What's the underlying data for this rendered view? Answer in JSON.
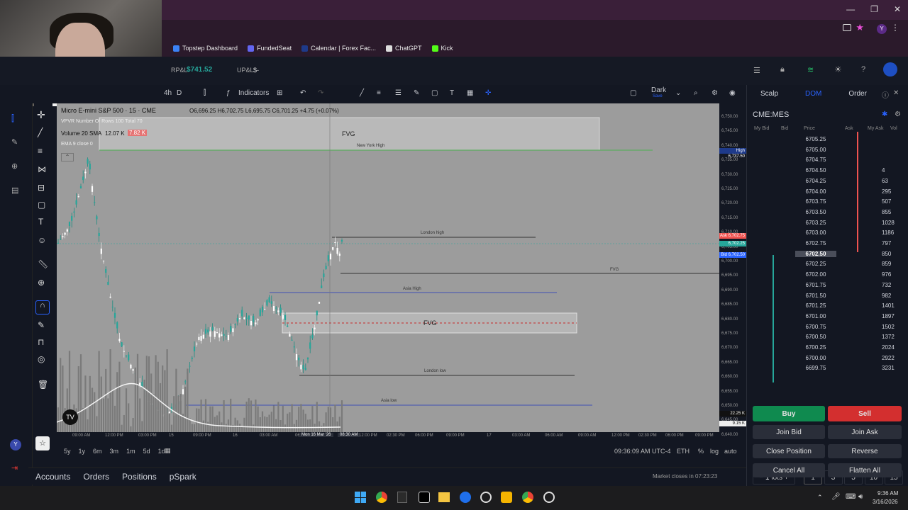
{
  "browser": {
    "bookmarks": [
      "Topstep Dashboard",
      "FundedSeat",
      "Calendar | Forex Fac...",
      "ChatGPT",
      "Kick"
    ],
    "bookmark_colors": [
      "#3b82f6",
      "#6366f1",
      "#1e3a8a",
      "#dddddd",
      "#53fc18"
    ],
    "profile_initial": "Y"
  },
  "header": {
    "rpl_label": "RP&L",
    "rpl_value": "$741.52",
    "upl_label": "UP&L",
    "upl_value": "$-",
    "positive_color": "#26a69a"
  },
  "toolbar": {
    "interval_4h": "4h",
    "interval_d": "D",
    "indicators": "Indicators",
    "theme": "Dark",
    "theme_sub": "Save"
  },
  "chart": {
    "symbol_line": "Micro E-mini S&P 500 · 15 · CME",
    "ohlc": "O6,696.25 H6,702.75 L6,695.75 C6,701.25 +4.75 (+0.07%)",
    "vpvr": "VPVR Number Of Rows 100 Total 70",
    "volume_label": "Volume 20 SMA",
    "volume_v1": "12.07 K",
    "volume_v2": "7.82 K",
    "ema_label": "EMA 9 close 0",
    "zones": {
      "fvg_top": "FVG",
      "new_york_high": "New York High",
      "london_high": "London high",
      "fvg_right": "FVG",
      "asia_high": "Asia High",
      "fvg_mid": "FVG",
      "london_low": "London low",
      "asia_low": "Asia low"
    }
  },
  "price_axis": {
    "ticks": [
      "6,750.00",
      "6,745.00",
      "6,740.00",
      "6,735.00",
      "6,730.00",
      "6,725.00",
      "6,720.00",
      "6,715.00",
      "6,710.00",
      "6,705.00",
      "6,700.00",
      "6,695.00",
      "6,690.00",
      "6,685.00",
      "6,680.00",
      "6,675.00",
      "6,670.00",
      "6,665.00",
      "6,660.00",
      "6,655.00",
      "6,650.00",
      "6,645.00",
      "6,640.00"
    ],
    "high_label": "High",
    "high_value": "6,737.50",
    "ask_label": "Ask",
    "ask_value": "6,702.75",
    "last_value": "6,702.25",
    "bid_label": "Bid",
    "bid_value": "6,702.50",
    "vol_a": "22.25 K",
    "vol_b": "9.15 K"
  },
  "time_axis": {
    "ticks": [
      "09:00 AM",
      "12:00 PM",
      "03:00 PM",
      "15",
      "09:00 PM",
      "16",
      "03:00 AM",
      "06",
      "12:00 PM",
      "02:30 PM",
      "06:00 PM",
      "09:00 PM",
      "17",
      "03:00 AM",
      "06:00 AM",
      "09:00 AM",
      "12:00 PM",
      "02:30 PM",
      "06:00 PM",
      "09:00 PM"
    ],
    "crosshair_label": "Mon 16 Mar '26",
    "crosshair_time": "08:30 AM"
  },
  "bottom_bar": {
    "ranges": [
      "5y",
      "1y",
      "6m",
      "3m",
      "1m",
      "5d",
      "1d"
    ],
    "clock": "09:36:09 AM UTC-4",
    "session": "ETH",
    "pct": "%",
    "log": "log",
    "auto": "auto"
  },
  "bottom_tabs": [
    "Accounts",
    "Orders",
    "Positions",
    "pSpark"
  ],
  "market_status": "Market closes in 07:23:23",
  "right_panel": {
    "tabs": [
      "Scalp",
      "DOM",
      "Order"
    ],
    "active_tab_color": "#2962ff",
    "symbol": "CME:MES",
    "columns": [
      "My Bid",
      "Bid",
      "Price",
      "Ask",
      "My Ask",
      "Vol"
    ],
    "rows": [
      {
        "price": "6705.25",
        "vol": ""
      },
      {
        "price": "6705.00",
        "vol": ""
      },
      {
        "price": "6704.75",
        "vol": ""
      },
      {
        "price": "6704.50",
        "vol": "4"
      },
      {
        "price": "6704.25",
        "vol": "63"
      },
      {
        "price": "6704.00",
        "vol": "295"
      },
      {
        "price": "6703.75",
        "vol": "507"
      },
      {
        "price": "6703.50",
        "vol": "855"
      },
      {
        "price": "6703.25",
        "vol": "1028"
      },
      {
        "price": "6703.00",
        "vol": "1186"
      },
      {
        "price": "6702.75",
        "vol": "797"
      },
      {
        "price": "6702.50",
        "vol": "850"
      },
      {
        "price": "6702.25",
        "vol": "859"
      },
      {
        "price": "6702.00",
        "vol": "976"
      },
      {
        "price": "6701.75",
        "vol": "732"
      },
      {
        "price": "6701.50",
        "vol": "982"
      },
      {
        "price": "6701.25",
        "vol": "1401"
      },
      {
        "price": "6701.00",
        "vol": "1897"
      },
      {
        "price": "6700.75",
        "vol": "1502"
      },
      {
        "price": "6700.50",
        "vol": "1372"
      },
      {
        "price": "6700.25",
        "vol": "2024"
      },
      {
        "price": "6700.00",
        "vol": "2922"
      },
      {
        "price": "6699.75",
        "vol": "3231"
      }
    ],
    "highlight_price": "6702.50",
    "lots_value": "1",
    "lots_label": "lots",
    "lot_presets": [
      "1",
      "3",
      "5",
      "10",
      "15"
    ],
    "buy": "Buy",
    "sell": "Sell",
    "buy_color": "#0f8a4f",
    "sell_color": "#d32f2f",
    "join_bid": "Join Bid",
    "join_ask": "Join Ask",
    "close_position": "Close Position",
    "reverse": "Reverse",
    "cancel_all": "Cancel All",
    "flatten_all": "Flatten All"
  },
  "taskbar": {
    "time": "9:36 AM",
    "date": "3/16/2026"
  }
}
